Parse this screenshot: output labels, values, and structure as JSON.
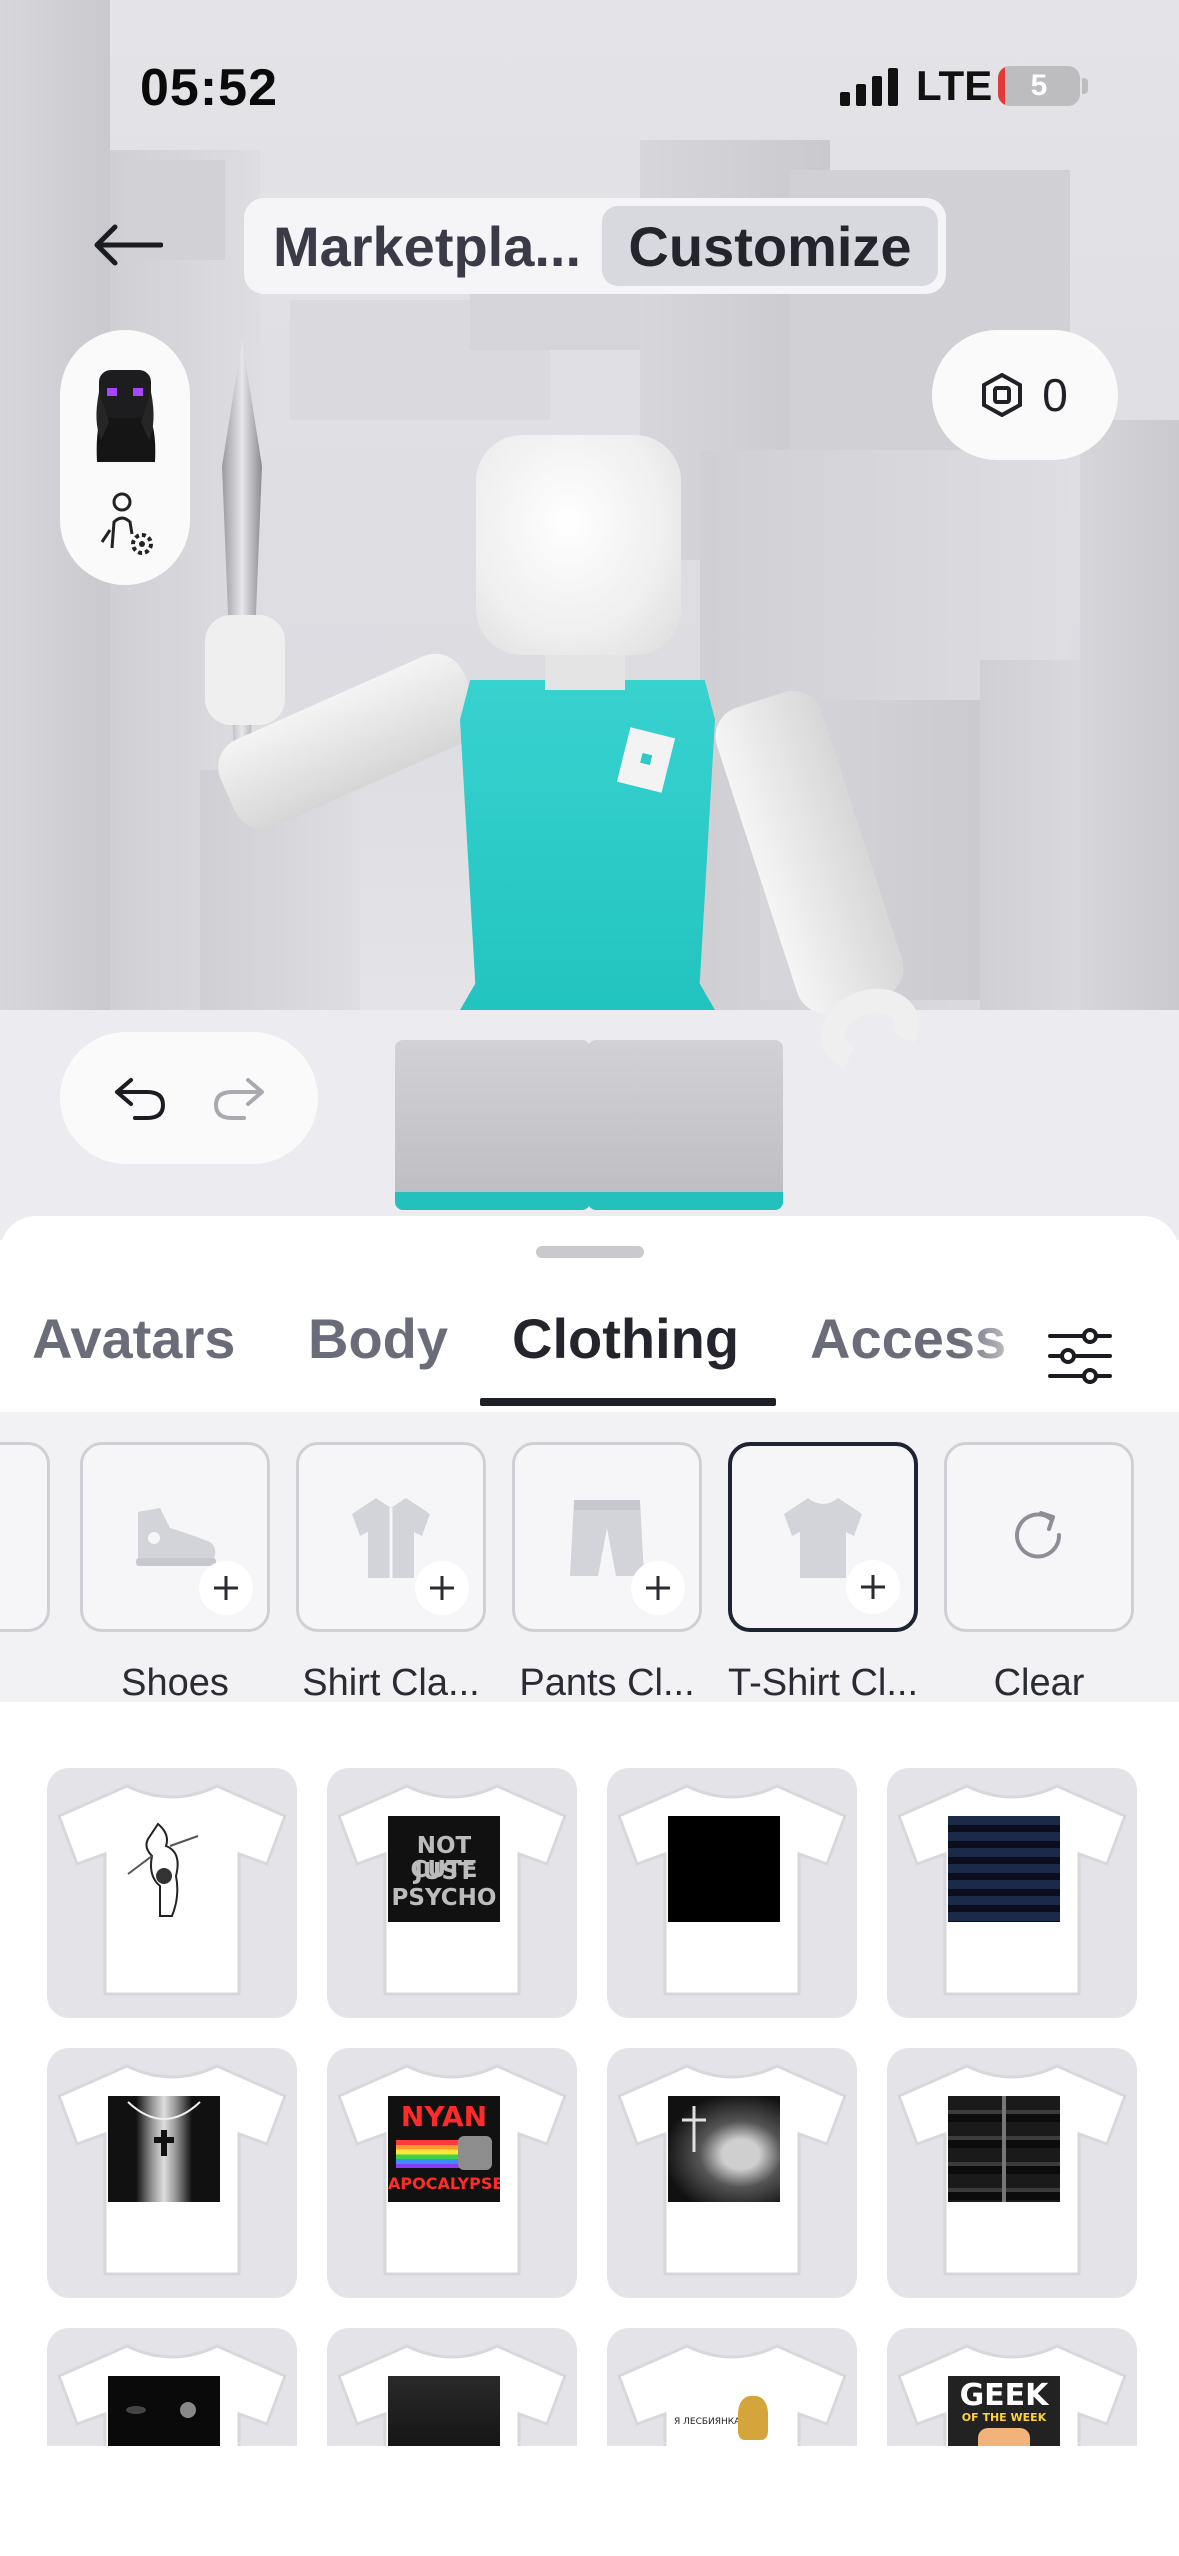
{
  "status_bar": {
    "time": "05:52",
    "network": "LTE",
    "battery": "5",
    "battery_level": 0.05
  },
  "header": {
    "tabs": [
      {
        "label": "Marketpla...",
        "active": false
      },
      {
        "label": "Customize",
        "active": true
      }
    ]
  },
  "currency": {
    "amount": "0"
  },
  "categories": {
    "tabs": [
      "Avatars",
      "Body",
      "Clothing",
      "Access"
    ],
    "active": "Clothing"
  },
  "subcategories": {
    "partial_label": "n",
    "items": [
      {
        "label": "Shoes",
        "icon": "shoe-icon"
      },
      {
        "label": "Shirt Cla...",
        "icon": "shirt-icon"
      },
      {
        "label": "Pants Cl...",
        "icon": "pants-icon"
      },
      {
        "label": "T-Shirt Cl...",
        "icon": "tshirt-icon",
        "selected": true
      },
      {
        "label": "Clear",
        "icon": "refresh-icon"
      }
    ]
  },
  "items": [
    {
      "graphic": "sketch figure"
    },
    {
      "graphic_text": [
        "NOT CUTE",
        "JUST",
        "PSYCHO"
      ]
    },
    {
      "graphic": "black square"
    },
    {
      "graphic": "navy stripes"
    },
    {
      "graphic": "cross necklace"
    },
    {
      "graphic_text": [
        "NYAN",
        "APOCALYPSE!"
      ]
    },
    {
      "graphic": "portrait photo"
    },
    {
      "graphic": "puffer jacket"
    },
    {
      "graphic": "dark logo"
    },
    {
      "graphic": "dark print"
    },
    {
      "graphic_text": [
        "Я ЛЕСБИЯНКА"
      ]
    },
    {
      "graphic_text": [
        "GEEK",
        "OF THE WEEK"
      ]
    }
  ],
  "colors": {
    "accent": "#1f2027",
    "shirt": "#2cc9c6",
    "tab_inactive": "#6b6c79",
    "selected_border": "#1e2333"
  }
}
